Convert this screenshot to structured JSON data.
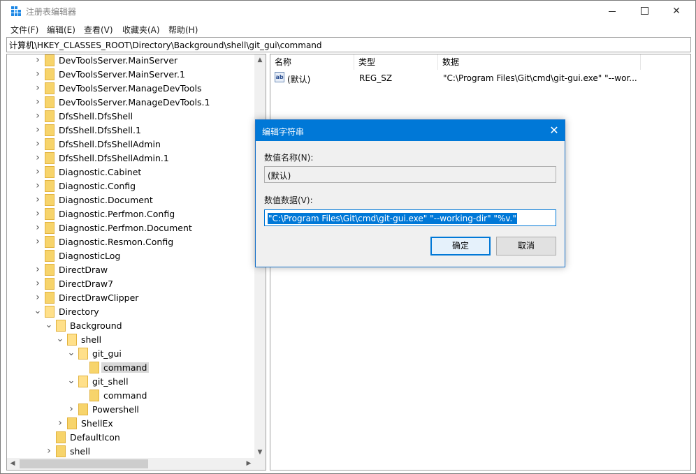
{
  "window": {
    "title": "注册表编辑器",
    "icon": "regedit-icon"
  },
  "menu": [
    "文件(F)",
    "编辑(E)",
    "查看(V)",
    "收藏夹(A)",
    "帮助(H)"
  ],
  "address": "计算机\\HKEY_CLASSES_ROOT\\Directory\\Background\\shell\\git_gui\\command",
  "tree": [
    {
      "label": "DevToolsServer.MainServer",
      "level": 0,
      "chevron": ">"
    },
    {
      "label": "DevToolsServer.MainServer.1",
      "level": 0,
      "chevron": ">"
    },
    {
      "label": "DevToolsServer.ManageDevTools",
      "level": 0,
      "chevron": ">"
    },
    {
      "label": "DevToolsServer.ManageDevTools.1",
      "level": 0,
      "chevron": ">"
    },
    {
      "label": "DfsShell.DfsShell",
      "level": 0,
      "chevron": ">"
    },
    {
      "label": "DfsShell.DfsShell.1",
      "level": 0,
      "chevron": ">"
    },
    {
      "label": "DfsShell.DfsShellAdmin",
      "level": 0,
      "chevron": ">"
    },
    {
      "label": "DfsShell.DfsShellAdmin.1",
      "level": 0,
      "chevron": ">"
    },
    {
      "label": "Diagnostic.Cabinet",
      "level": 0,
      "chevron": ">"
    },
    {
      "label": "Diagnostic.Config",
      "level": 0,
      "chevron": ">"
    },
    {
      "label": "Diagnostic.Document",
      "level": 0,
      "chevron": ">"
    },
    {
      "label": "Diagnostic.Perfmon.Config",
      "level": 0,
      "chevron": ">"
    },
    {
      "label": "Diagnostic.Perfmon.Document",
      "level": 0,
      "chevron": ">"
    },
    {
      "label": "Diagnostic.Resmon.Config",
      "level": 0,
      "chevron": ">"
    },
    {
      "label": "DiagnosticLog",
      "level": 0,
      "chevron": ""
    },
    {
      "label": "DirectDraw",
      "level": 0,
      "chevron": ">"
    },
    {
      "label": "DirectDraw7",
      "level": 0,
      "chevron": ">"
    },
    {
      "label": "DirectDrawClipper",
      "level": 0,
      "chevron": ">"
    },
    {
      "label": "Directory",
      "level": 0,
      "chevron": "v"
    },
    {
      "label": "Background",
      "level": 1,
      "chevron": "v"
    },
    {
      "label": "shell",
      "level": 2,
      "chevron": "v"
    },
    {
      "label": "git_gui",
      "level": 3,
      "chevron": "v"
    },
    {
      "label": "command",
      "level": 4,
      "chevron": "",
      "selected": true
    },
    {
      "label": "git_shell",
      "level": 3,
      "chevron": "v"
    },
    {
      "label": "command",
      "level": 4,
      "chevron": ""
    },
    {
      "label": "Powershell",
      "level": 3,
      "chevron": ">"
    },
    {
      "label": "ShellEx",
      "level": 2,
      "chevron": ">"
    },
    {
      "label": "DefaultIcon",
      "level": 1,
      "chevron": ""
    },
    {
      "label": "shell",
      "level": 1,
      "chevron": ">"
    }
  ],
  "list": {
    "columns": [
      "名称",
      "类型",
      "数据"
    ],
    "rows": [
      {
        "name": "(默认)",
        "type": "REG_SZ",
        "data": "\"C:\\Program Files\\Git\\cmd\\git-gui.exe\" \"--wor...",
        "icon_text": "ab"
      }
    ]
  },
  "dialog": {
    "title": "编辑字符串",
    "name_label": "数值名称(N):",
    "name_value": "(默认)",
    "data_label": "数值数据(V):",
    "data_value": "\"C:\\Program Files\\Git\\cmd\\git-gui.exe\" \"--working-dir\" \"%v.\"",
    "ok_label": "确定",
    "cancel_label": "取消"
  }
}
